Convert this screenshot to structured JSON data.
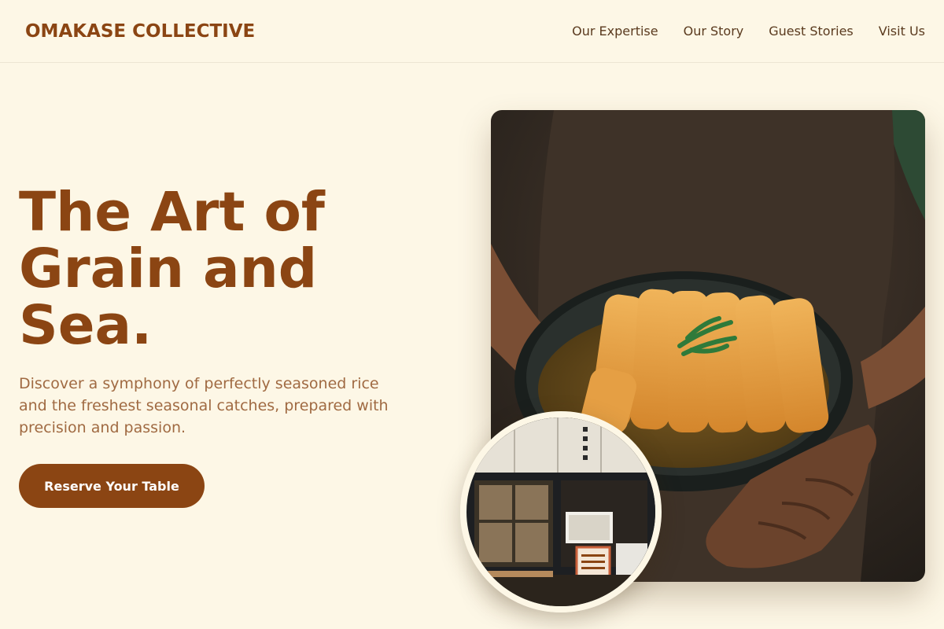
{
  "brand": {
    "name": "OMAKASE COLLECTIVE"
  },
  "nav": {
    "items": [
      {
        "label": "Our Expertise"
      },
      {
        "label": "Our Story"
      },
      {
        "label": "Guest Stories"
      },
      {
        "label": "Visit Us"
      }
    ]
  },
  "hero": {
    "title": "The Art of Grain and Sea.",
    "subtitle": "Discover a symphony of perfectly seasoned rice and the freshest seasonal catches, prepared with precision and passion.",
    "cta_label": "Reserve Your Table"
  },
  "colors": {
    "background": "#fdf7e6",
    "brand": "#8b4513",
    "nav_text": "#5a3a1e",
    "subtitle_text": "#a06a42",
    "button_text": "#ffffff"
  },
  "images": {
    "main_photo": "hands-holding-katsu-curry-bowl",
    "inset_photo": "japanese-restaurant-storefront"
  }
}
